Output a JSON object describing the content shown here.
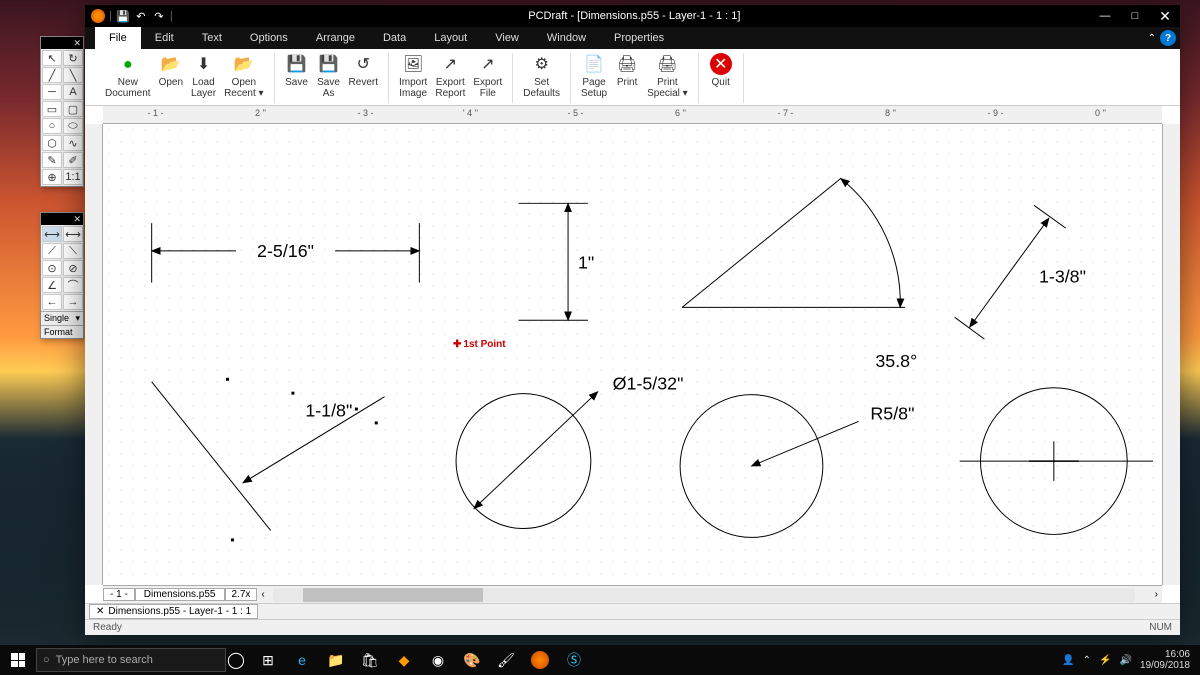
{
  "titlebar": {
    "title": "PCDraft - [Dimensions.p55 - Layer-1 - 1 : 1]"
  },
  "menubar": {
    "items": [
      "File",
      "Edit",
      "Text",
      "Options",
      "Arrange",
      "Data",
      "Layout",
      "View",
      "Window",
      "Properties"
    ],
    "active": "File"
  },
  "ribbon": {
    "groups": [
      [
        {
          "label": "New Document",
          "icon": "●",
          "cls": "ic-new"
        },
        {
          "label": "Open",
          "icon": "📂",
          "cls": ""
        },
        {
          "label": "Load Layer",
          "icon": "⬇",
          "cls": ""
        },
        {
          "label": "Open Recent ▾",
          "icon": "📂",
          "cls": ""
        }
      ],
      [
        {
          "label": "Save",
          "icon": "💾",
          "cls": "ic-save"
        },
        {
          "label": "Save As",
          "icon": "💾",
          "cls": "ic-save"
        },
        {
          "label": "Revert",
          "icon": "↺",
          "cls": ""
        }
      ],
      [
        {
          "label": "Import Image",
          "icon": "🖼",
          "cls": ""
        },
        {
          "label": "Export Report",
          "icon": "↗",
          "cls": ""
        },
        {
          "label": "Export File",
          "icon": "↗",
          "cls": ""
        }
      ],
      [
        {
          "label": "Set Defaults",
          "icon": "⚙",
          "cls": ""
        }
      ],
      [
        {
          "label": "Page Setup",
          "icon": "📄",
          "cls": ""
        },
        {
          "label": "Print",
          "icon": "🖨",
          "cls": ""
        },
        {
          "label": "Print Special ▾",
          "icon": "🖨",
          "cls": ""
        }
      ],
      [
        {
          "label": "Quit",
          "icon": "✕",
          "cls": "ic-quit"
        }
      ]
    ]
  },
  "ruler": {
    "ticks": [
      "- 1 -",
      "2 ''",
      "- 3 -",
      "' 4 ''",
      "- 5 -",
      "6 ''",
      "- 7 -",
      "8 ''",
      "- 9 -",
      " 0 ''"
    ]
  },
  "drawing": {
    "dim_h": "2-5/16\"",
    "dim_v": "1\"",
    "dim_angled": "1-1/8\"",
    "dim_dia": "Ø1-5/32\"",
    "dim_rad": "R5/8\"",
    "dim_ang": "35.8°",
    "dim_slant": "1-3/8\""
  },
  "cursor_hint": "1st Point",
  "bottom_tabs": {
    "file": "Dimensions.p55",
    "zoom": "2.7x"
  },
  "doc_tab": "Dimensions.p55 - Layer-1 - 1 : 1",
  "status": {
    "left": "Ready",
    "right": "NUM"
  },
  "palette2": {
    "foot1": "Single",
    "foot2": "Format",
    "arrow": "▾"
  },
  "palette1": {
    "scale": "1:1"
  },
  "taskbar": {
    "search_placeholder": "Type here to search",
    "time": "16:06",
    "date": "19/09/2018"
  }
}
